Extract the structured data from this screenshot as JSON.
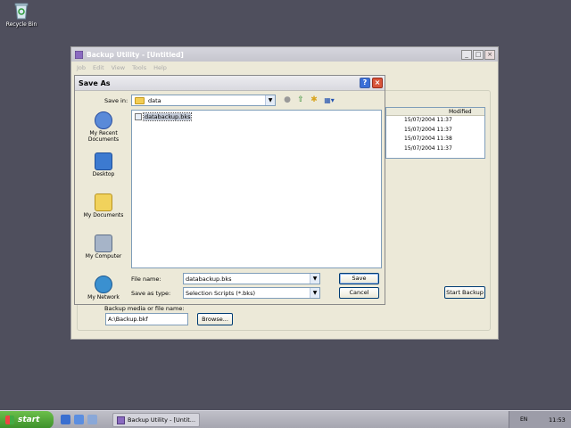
{
  "desktop": {
    "recycle_bin_label": "Recycle Bin"
  },
  "main_window": {
    "title": "Backup Utility - [Untitled]",
    "menu": [
      "Job",
      "Edit",
      "View",
      "Tools",
      "Help"
    ],
    "job_list": {
      "header_modified": "Modified",
      "rows": [
        "15/07/2004 11:37",
        "15/07/2004 11:37",
        "15/07/2004 11:38",
        "15/07/2004 11:37"
      ]
    },
    "start_backup_label": "Start Backup",
    "media_label": "Backup media or file name:",
    "media_value": "A:\\Backup.bkf",
    "browse_label": "Browse..."
  },
  "dialog": {
    "title": "Save As",
    "save_in_label": "Save in:",
    "save_in_value": "data",
    "places": [
      "My Recent Documents",
      "Desktop",
      "My Documents",
      "My Computer",
      "My Network"
    ],
    "files": [
      "databackup.bks"
    ],
    "file_name_label": "File name:",
    "file_name_value": "databackup.bks",
    "file_type_label": "Save as type:",
    "file_type_value": "Selection Scripts (*.bks)",
    "save_label": "Save",
    "cancel_label": "Cancel"
  },
  "taskbar": {
    "start_label": "start",
    "task_label": "Backup Utility - [Untit...",
    "lang": "EN",
    "clock": "11:53"
  }
}
